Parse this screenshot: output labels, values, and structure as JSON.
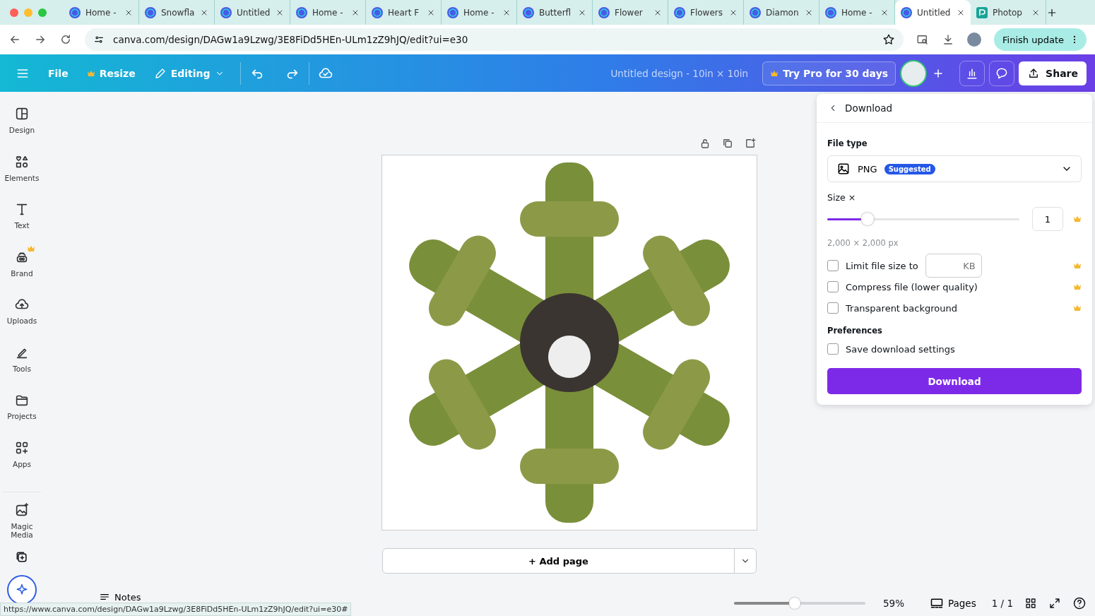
{
  "browser": {
    "tabs": [
      {
        "title": "Home -",
        "selected": false,
        "kind": "canva"
      },
      {
        "title": "Snowfla",
        "selected": false,
        "kind": "canva"
      },
      {
        "title": "Untitled",
        "selected": false,
        "kind": "canva"
      },
      {
        "title": "Home -",
        "selected": false,
        "kind": "canva"
      },
      {
        "title": "Heart F",
        "selected": false,
        "kind": "canva"
      },
      {
        "title": "Home -",
        "selected": false,
        "kind": "canva"
      },
      {
        "title": "Butterfl",
        "selected": false,
        "kind": "canva"
      },
      {
        "title": "Flower",
        "selected": false,
        "kind": "canva"
      },
      {
        "title": "Flowers",
        "selected": false,
        "kind": "canva"
      },
      {
        "title": "Diamon",
        "selected": false,
        "kind": "canva"
      },
      {
        "title": "Home -",
        "selected": false,
        "kind": "canva"
      },
      {
        "title": "Untitled",
        "selected": true,
        "kind": "canva"
      },
      {
        "title": "Photop",
        "selected": false,
        "kind": "photopea"
      }
    ],
    "url": "canva.com/design/DAGw1a9Lzwg/3E8FiDd5HEn-ULm1zZ9hJQ/edit?ui=e30",
    "finish_update": "Finish update"
  },
  "toolbar": {
    "file": "File",
    "resize": "Resize",
    "editing": "Editing",
    "title": "Untitled design - 10in × 10in",
    "try_pro": "Try Pro for 30 days",
    "share": "Share"
  },
  "sidebar": {
    "items": [
      {
        "label": "Design",
        "premium": false
      },
      {
        "label": "Elements",
        "premium": false
      },
      {
        "label": "Text",
        "premium": false
      },
      {
        "label": "Brand",
        "premium": true
      },
      {
        "label": "Uploads",
        "premium": false
      },
      {
        "label": "Tools",
        "premium": false
      },
      {
        "label": "Projects",
        "premium": false
      },
      {
        "label": "Apps",
        "premium": false
      },
      {
        "label": "Magic Media",
        "premium": false
      }
    ]
  },
  "canvas": {
    "add_page": "+ Add page"
  },
  "download_panel": {
    "title": "Download",
    "file_type_label": "File type",
    "file_type": "PNG",
    "file_type_badge": "Suggested",
    "size_label": "Size ×",
    "size_slider": {
      "level": 0.21
    },
    "size_value": "1",
    "dimensions": "2,000 × 2,000 px",
    "options": [
      {
        "label": "Limit file size to",
        "checked": false,
        "kind": "limit",
        "placeholder": "KB"
      },
      {
        "label": "Compress file (lower quality)",
        "checked": false,
        "kind": "plain"
      },
      {
        "label": "Transparent background",
        "checked": false,
        "kind": "plain"
      }
    ],
    "preferences_label": "Preferences",
    "save_settings": {
      "label": "Save download settings",
      "checked": false
    },
    "download": "Download"
  },
  "bottom_bar": {
    "notes": "Notes",
    "zoom_slider": {
      "level": 0.46
    },
    "zoom": "59%",
    "pages": "Pages",
    "page_count": "1 / 1"
  },
  "status_url": "https://www.canva.com/design/DAGw1a9Lzwg/3E8FiDd5HEn-ULm1zZ9hJQ/edit?ui=e30#"
}
